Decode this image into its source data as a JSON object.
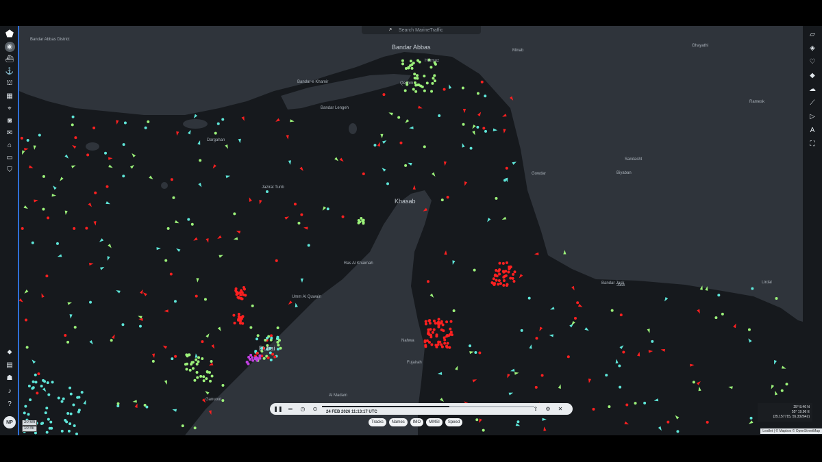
{
  "search": {
    "placeholder": "Search MarineTraffic"
  },
  "left_rail": {
    "top_icons": [
      "globe-icon",
      "ship-icon",
      "anchor-icon",
      "port-icon",
      "building-icon",
      "antenna-icon",
      "camera-icon",
      "mail-icon",
      "factory-icon",
      "id-card-icon",
      "shield-icon"
    ],
    "bottom_icons": [
      "tag-icon",
      "document-icon",
      "group-icon",
      "bell-icon",
      "help-icon"
    ],
    "avatar_initials": "NP"
  },
  "right_rail": {
    "icons": [
      "map-icon",
      "filter-icon",
      "heart-icon",
      "layers-icon",
      "weather-icon",
      "ruler-icon",
      "play-icon",
      "text-icon",
      "fullscreen-icon"
    ]
  },
  "places": [
    {
      "name": "Bandar Abbas",
      "big": true
    },
    {
      "name": "Hormuz",
      "big": false
    },
    {
      "name": "Qeshm",
      "big": false
    },
    {
      "name": "Bandar-e Khamir",
      "big": false
    },
    {
      "name": "Bandar Lengeh",
      "big": false
    },
    {
      "name": "Minab",
      "big": false
    },
    {
      "name": "Dargahan",
      "big": false
    },
    {
      "name": "Khasab",
      "big": true
    },
    {
      "name": "Ras Al Khaimah",
      "big": false
    },
    {
      "name": "Umm Al Quwain",
      "big": false
    },
    {
      "name": "Dubai",
      "big": true
    },
    {
      "name": "Fujairah",
      "big": false
    },
    {
      "name": "Nahwa",
      "big": false
    },
    {
      "name": "Al Madam",
      "big": false
    },
    {
      "name": "Bandar Jask",
      "big": false
    },
    {
      "name": "Jask",
      "big": false
    },
    {
      "name": "Ghayathi",
      "big": false
    },
    {
      "name": "Jazirat Tunb",
      "big": false
    },
    {
      "name": "Lirdal",
      "big": false
    },
    {
      "name": "Ramesk",
      "big": false
    },
    {
      "name": "Bandar Abbas District",
      "big": false
    },
    {
      "name": "Ganuout",
      "big": false
    },
    {
      "name": "Sandasht",
      "big": false
    },
    {
      "name": "Biyaban",
      "big": false
    },
    {
      "name": "Gowdar",
      "big": false
    }
  ],
  "player": {
    "date": "24 FEB 2026 11:13:17 UTC",
    "progress": 0.6
  },
  "chips": [
    "Tracks",
    "Names",
    "IMO",
    "MMSI",
    "Speed"
  ],
  "scale": {
    "km": "20 km",
    "mi": "10 mi"
  },
  "coords": {
    "lat": "25° 8.46 N",
    "lon": "55° 19.96 E",
    "decimal": "(25.157715, 55.332642)"
  },
  "attribution": "Leaflet | © Mapbox © OpenStreetMap",
  "colors": {
    "land": "#2f343b",
    "sea": "#16191d",
    "accent": "#2f6fd6",
    "vessel_red": "#ff2020",
    "vessel_green": "#9cf27a",
    "vessel_cyan": "#5ee6d9",
    "vessel_blue": "#2f6fd6",
    "vessel_magenta": "#c040e0"
  }
}
